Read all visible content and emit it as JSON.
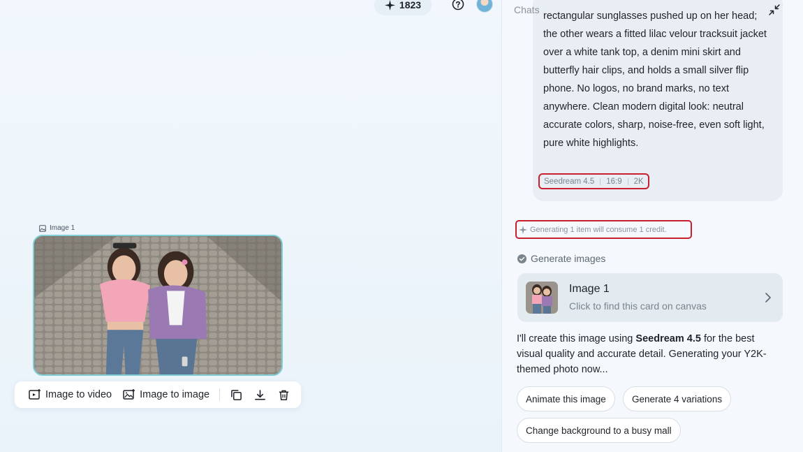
{
  "topbar": {
    "credits": "1823",
    "icons": {
      "credits": "sparkle-icon",
      "help": "question-circle-icon"
    }
  },
  "canvas": {
    "image_label": "Image 1",
    "toolbar": {
      "image_to_video": "Image to video",
      "image_to_image": "Image to image",
      "icons": [
        "copy-icon",
        "download-icon",
        "trash-icon"
      ]
    }
  },
  "chat": {
    "title": "Chats",
    "prompt": {
      "lines": [
        "rectangular sunglasses pushed up on her head;",
        "the other wears a fitted lilac velour tracksuit jacket",
        "over a white tank top, a denim mini skirt and",
        "butterfly hair clips, and holds a small silver flip",
        "phone. No logos, no brand marks, no text",
        "anywhere. Clean modern digital look: neutral",
        "accurate colors, sharp, noise-free, even soft light,",
        "pure white highlights."
      ],
      "tags": [
        "Seedream 4.5",
        "16:9",
        "2K"
      ]
    },
    "consume_note": "Generating 1 item will consume 1 credit.",
    "generate_title": "Generate images",
    "result_card": {
      "title": "Image 1",
      "subtitle": "Click to find this card on canvas"
    },
    "reply": {
      "before": "I'll create this image using ",
      "model": "Seedream 4.5",
      "after": " for the best visual quality and accurate detail. Generating your Y2K-themed photo now..."
    },
    "suggestions": [
      "Animate this image",
      "Generate 4 variations",
      "Change background to a busy mall"
    ]
  },
  "colors": {
    "highlight_border": "#c8202f",
    "image_border": "#7ed0d6",
    "panel_bg": "#f5f9fd"
  }
}
